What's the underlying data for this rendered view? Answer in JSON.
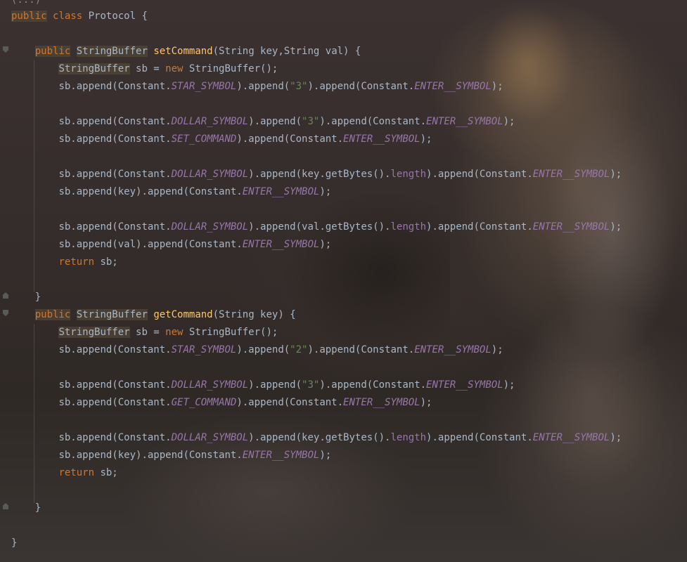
{
  "editor": {
    "collapsed_header": "(...)",
    "class_decl": {
      "kw1": "public",
      "kw2": "class",
      "name": "Protocol",
      "brace": "{"
    },
    "methods": [
      {
        "kw": "public",
        "type": "StringBuffer",
        "name": "setCommand",
        "params": "(String key,String val) {",
        "decl": {
          "type": "StringBuffer",
          "rest": " sb = ",
          "kw": "new",
          "ctor": " StringBuffer();"
        },
        "lines": [
          {
            "a": "sb.append(Constant.",
            "c1": "STAR_SYMBOL",
            "b": ").append(",
            "s": "\"3\"",
            "d": ").append(Constant.",
            "c2": "ENTER__SYMBOL",
            "e": ");"
          },
          null,
          {
            "a": "sb.append(Constant.",
            "c1": "DOLLAR_SYMBOL",
            "b": ").append(",
            "s": "\"3\"",
            "d": ").append(Constant.",
            "c2": "ENTER__SYMBOL",
            "e": ");"
          },
          {
            "a": "sb.append(Constant.",
            "c1": "SET_COMMAND",
            "b": ").append(Constant.",
            "c2": "ENTER__SYMBOL",
            "e": ");"
          },
          null,
          {
            "a": "sb.append(Constant.",
            "c1": "DOLLAR_SYMBOL",
            "b": ").append(key.getBytes().",
            "f": "length",
            "d": ").append(Constant.",
            "c2": "ENTER__SYMBOL",
            "e": ");"
          },
          {
            "a": "sb.append(key).append(Constant.",
            "c2": "ENTER__SYMBOL",
            "e": ");"
          },
          null,
          {
            "a": "sb.append(Constant.",
            "c1": "DOLLAR_SYMBOL",
            "b": ").append(val.getBytes().",
            "f": "length",
            "d": ").append(Constant.",
            "c2": "ENTER__SYMBOL",
            "e": ");"
          },
          {
            "a": "sb.append(val).append(Constant.",
            "c2": "ENTER__SYMBOL",
            "e": ");"
          }
        ],
        "return_kw": "return",
        "return_rest": " sb;"
      },
      {
        "kw": "public",
        "type": "StringBuffer",
        "name": "getCommand",
        "params": "(String key) {",
        "decl": {
          "type": "StringBuffer",
          "rest": " sb = ",
          "kw": "new",
          "ctor": " StringBuffer();"
        },
        "lines": [
          {
            "a": "sb.append(Constant.",
            "c1": "STAR_SYMBOL",
            "b": ").append(",
            "s": "\"2\"",
            "d": ").append(Constant.",
            "c2": "ENTER__SYMBOL",
            "e": ");"
          },
          null,
          {
            "a": "sb.append(Constant.",
            "c1": "DOLLAR_SYMBOL",
            "b": ").append(",
            "s": "\"3\"",
            "d": ").append(Constant.",
            "c2": "ENTER__SYMBOL",
            "e": ");"
          },
          {
            "a": "sb.append(Constant.",
            "c1": "GET_COMMAND",
            "b": ").append(Constant.",
            "c2": "ENTER__SYMBOL",
            "e": ");"
          },
          null,
          {
            "a": "sb.append(Constant.",
            "c1": "DOLLAR_SYMBOL",
            "b": ").append(key.getBytes().",
            "f": "length",
            "d": ").append(Constant.",
            "c2": "ENTER__SYMBOL",
            "e": ");"
          },
          {
            "a": "sb.append(key).append(Constant.",
            "c2": "ENTER__SYMBOL",
            "e": ");"
          }
        ],
        "return_kw": "return",
        "return_rest": " sb;"
      }
    ],
    "close_brace": "}"
  },
  "colors": {
    "keyword": "#cc7832",
    "method": "#ffc66d",
    "constant": "#9876aa",
    "string": "#6a8759",
    "text": "#a9b7c6"
  }
}
